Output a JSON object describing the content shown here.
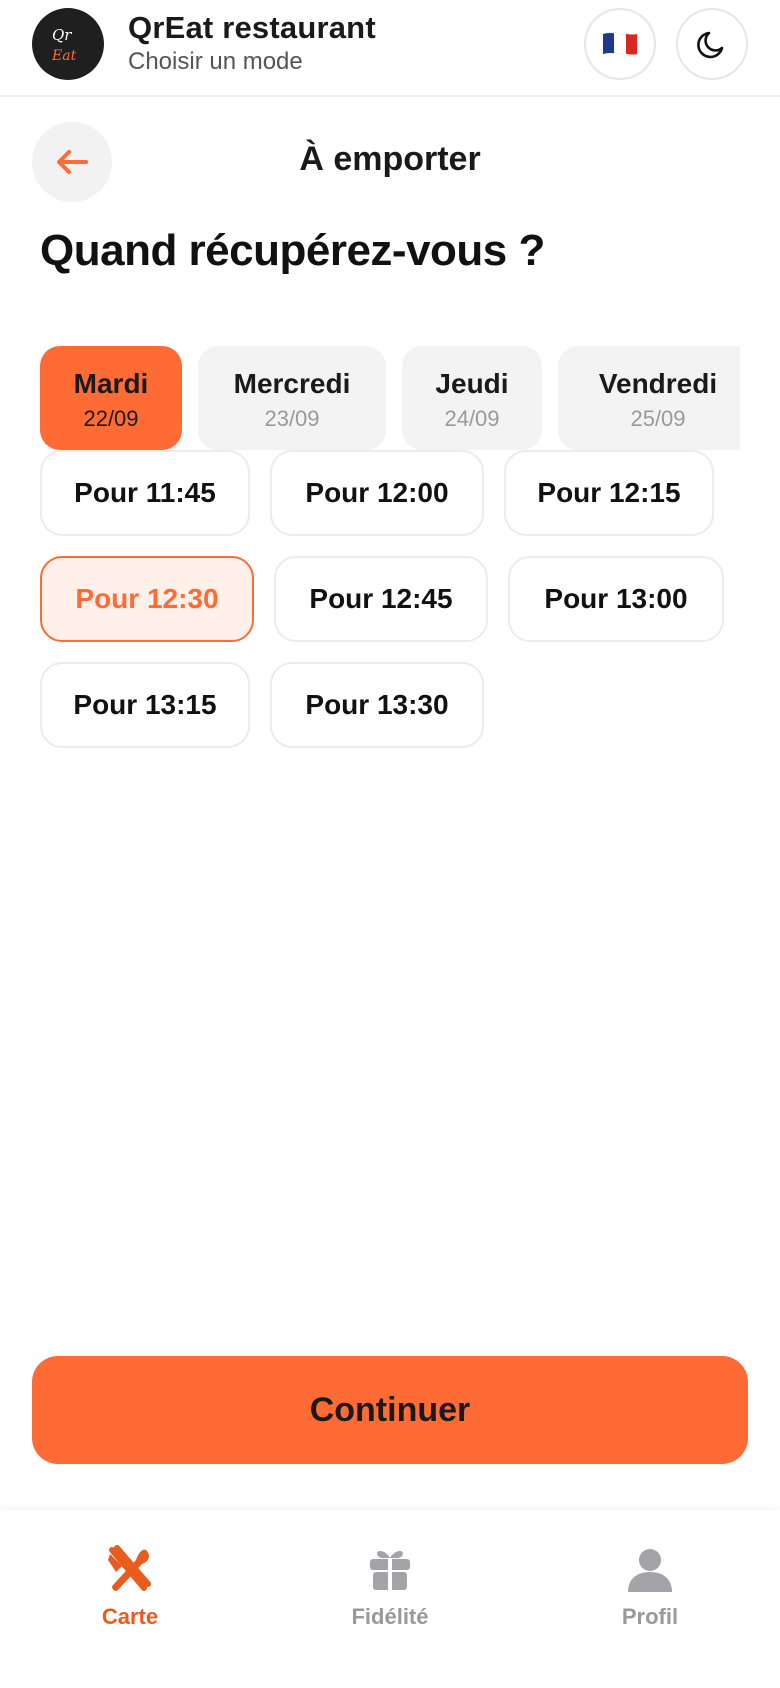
{
  "header": {
    "logo_text_top": "Qr",
    "logo_text_bottom": "Eat",
    "restaurant_name": "QrEat restaurant",
    "subtitle": "Choisir un mode",
    "language_flag_icon": "flag-fr-icon",
    "theme_icon": "moon-icon"
  },
  "title_bar": {
    "back_icon": "arrow-left-icon",
    "title": "À emporter"
  },
  "question": "Quand récupérez-vous ?",
  "days": [
    {
      "name": "Mardi",
      "date": "22/09",
      "selected": true
    },
    {
      "name": "Mercredi",
      "date": "23/09",
      "selected": false
    },
    {
      "name": "Jeudi",
      "date": "24/09",
      "selected": false
    },
    {
      "name": "Vendredi",
      "date": "25/09",
      "selected": false
    }
  ],
  "slots": [
    {
      "label": "Pour 11:45",
      "selected": false
    },
    {
      "label": "Pour 12:00",
      "selected": false
    },
    {
      "label": "Pour 12:15",
      "selected": false
    },
    {
      "label": "Pour 12:30",
      "selected": true
    },
    {
      "label": "Pour 12:45",
      "selected": false
    },
    {
      "label": "Pour 13:00",
      "selected": false
    },
    {
      "label": "Pour 13:15",
      "selected": false
    },
    {
      "label": "Pour 13:30",
      "selected": false
    }
  ],
  "continue_label": "Continuer",
  "bottom_nav": [
    {
      "label": "Carte",
      "icon": "cutlery-icon",
      "active": true
    },
    {
      "label": "Fidélité",
      "icon": "gift-icon",
      "active": false
    },
    {
      "label": "Profil",
      "icon": "user-icon",
      "active": false
    }
  ],
  "colors": {
    "accent": "#ff6b35",
    "accent_light": "#fff1ea",
    "muted": "#999999"
  }
}
